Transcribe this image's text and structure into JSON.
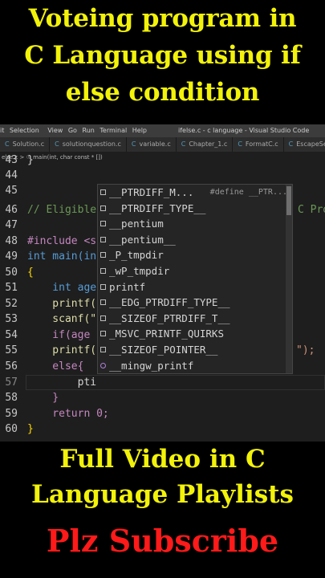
{
  "title_lines": [
    "Voteing program in",
    "C Language using if",
    "else condition"
  ],
  "menubar": {
    "items": [
      "it",
      "Selection",
      "View",
      "Go",
      "Run",
      "Terminal",
      "Help"
    ],
    "window_title": "ifelse.c - c language - Visual Studio Code"
  },
  "tabs": [
    "Solution.c",
    "solutionquestion.c",
    "variable.c",
    "Chapter_1.c",
    "FormatC.c",
    "EscapeSeq"
  ],
  "breadcrumb": "else.c > ☉ main(int, char const * [])",
  "code": {
    "lines": [
      {
        "num": "43",
        "text": "}"
      },
      {
        "num": "44",
        "text": ""
      },
      {
        "num": "45",
        "text": ""
      },
      {
        "num": "46",
        "text": "// Eligible"
      },
      {
        "num": "47",
        "text": ""
      },
      {
        "num": "48",
        "text": "#include <s"
      },
      {
        "num": "49",
        "text": "int main(in"
      },
      {
        "num": "50",
        "text": "{"
      },
      {
        "num": "51",
        "text": "    int age"
      },
      {
        "num": "52",
        "text": "    printf("
      },
      {
        "num": "53",
        "text": "    scanf(\""
      },
      {
        "num": "54",
        "text": "    if(age"
      },
      {
        "num": "55",
        "text": "    printf("
      },
      {
        "num": "56",
        "text": "    else{"
      },
      {
        "num": "57",
        "text": "        pti"
      },
      {
        "num": "58",
        "text": "    }"
      },
      {
        "num": "59",
        "text": "    return 0;"
      },
      {
        "num": "60",
        "text": "}"
      }
    ],
    "right_fragment_46": "C Pro",
    "right_fragment_55": "\");"
  },
  "suggestions": [
    {
      "label": "__PTRDIFF_M...",
      "detail": "#define __PTR...",
      "kind": "abc"
    },
    {
      "label": "__PTRDIFF_TYPE__",
      "detail": "",
      "kind": "abc"
    },
    {
      "label": "__pentium",
      "detail": "",
      "kind": "abc"
    },
    {
      "label": "__pentium__",
      "detail": "",
      "kind": "abc"
    },
    {
      "label": "_P_tmpdir",
      "detail": "",
      "kind": "abc"
    },
    {
      "label": "_wP_tmpdir",
      "detail": "",
      "kind": "abc"
    },
    {
      "label": "printf",
      "detail": "",
      "kind": "abc"
    },
    {
      "label": "__EDG_PTRDIFF_TYPE__",
      "detail": "",
      "kind": "abc"
    },
    {
      "label": "__SIZEOF_PTRDIFF_T__",
      "detail": "",
      "kind": "abc"
    },
    {
      "label": "_MSVC_PRINTF_QUIRKS",
      "detail": "",
      "kind": "abc"
    },
    {
      "label": "__SIZEOF_POINTER__",
      "detail": "",
      "kind": "abc"
    },
    {
      "label": "__mingw_printf",
      "detail": "",
      "kind": "fn"
    }
  ],
  "footer": {
    "line1": "Full Video in C",
    "line2": "Language Playlists",
    "line3": "Plz Subscribe"
  },
  "colors": {
    "title_yellow": "#f2f20a",
    "subscribe_red": "#ff1a1a",
    "match_blue": "#18a3ff",
    "editor_bg": "#1e1e1e"
  }
}
